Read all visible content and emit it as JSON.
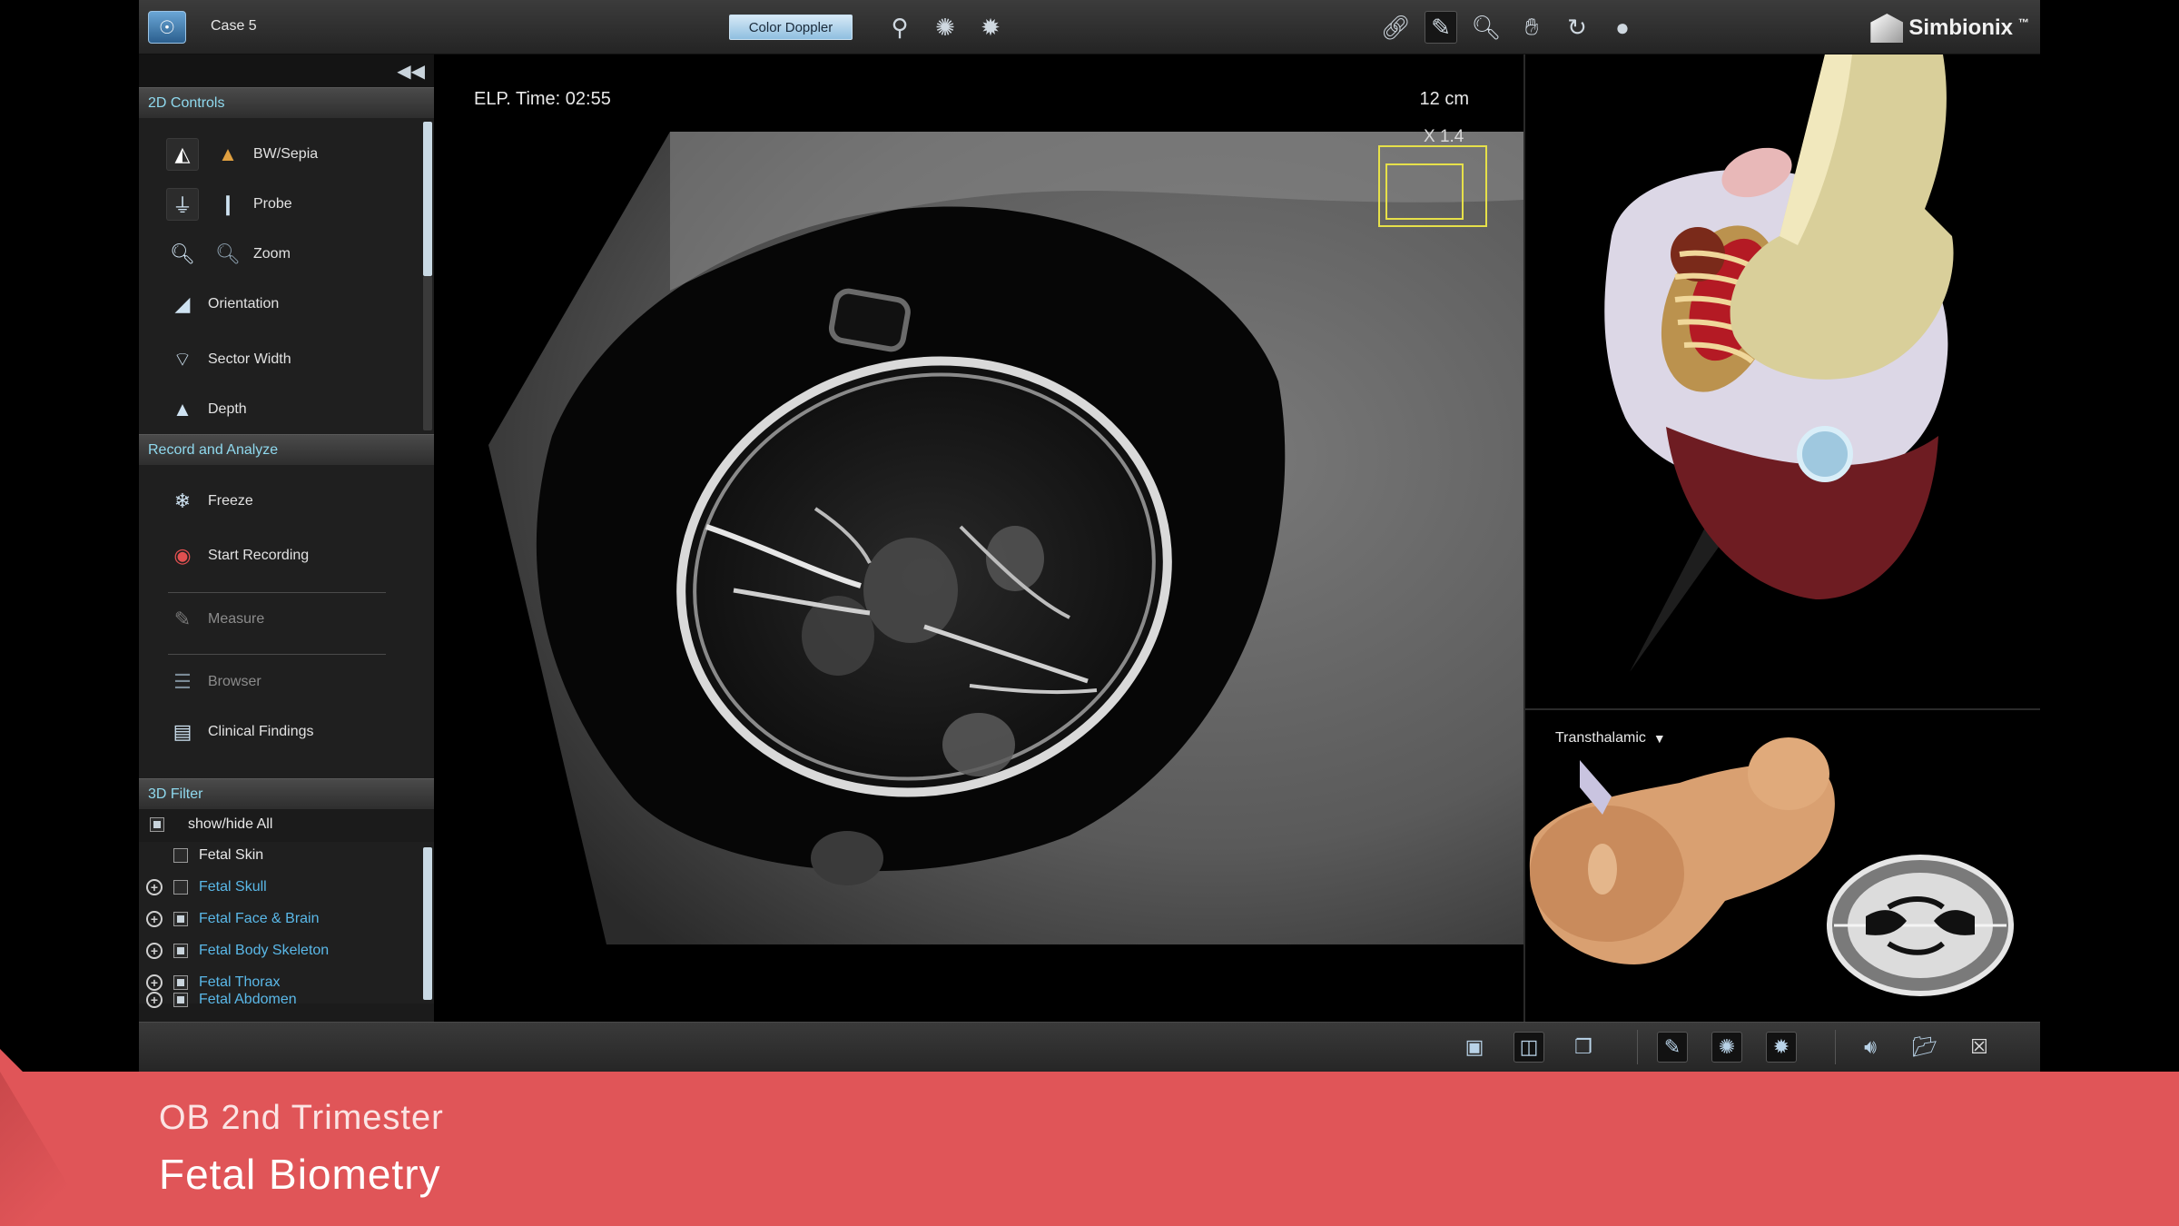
{
  "topbar": {
    "case_label": "Case 5",
    "color_doppler_label": "Color Doppler",
    "brand": "Simbionix",
    "brand_tm": "™"
  },
  "left_panel": {
    "sections": {
      "controls_2d": "2D Controls",
      "record_analyze": "Record and Analyze",
      "filter_3d": "3D Filter"
    },
    "controls_2d": [
      "BW/Sepia",
      "Probe",
      "Zoom",
      "Orientation",
      "Sector Width",
      "Depth"
    ],
    "record_analyze": [
      "Freeze",
      "Start Recording",
      "Measure",
      "Browser",
      "Clinical Findings"
    ],
    "filter_show_all": "show/hide All",
    "filter_items": [
      "Fetal Skin",
      "Fetal Skull",
      "Fetal Face & Brain",
      "Fetal Body Skeleton",
      "Fetal Thorax",
      "Fetal Abdomen"
    ]
  },
  "ultrasound": {
    "elp_time": "ELP. Time: 02:55",
    "depth": "12 cm",
    "zoom_factor": "X 1.4"
  },
  "plane_view": {
    "plane_name": "Transthalamic"
  },
  "banner": {
    "subtitle": "OB 2nd Trimester",
    "title": "Fetal Biometry"
  },
  "colors": {
    "accent_header": "#8fd9ee",
    "filter_link": "#5ab8e8",
    "banner": "#e05558",
    "zoom_box": "#e6e04a"
  }
}
